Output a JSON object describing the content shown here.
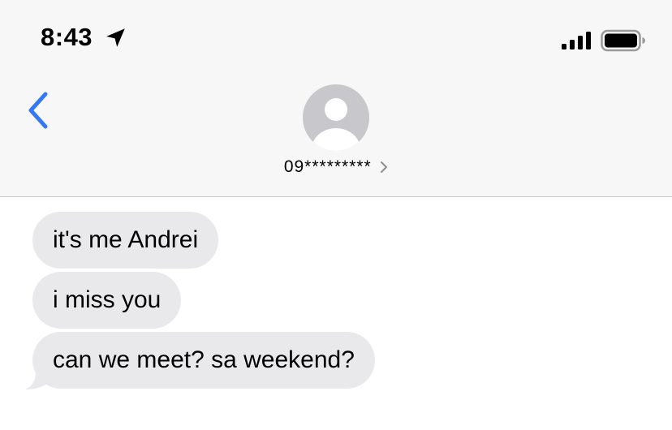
{
  "status_bar": {
    "time": "8:43",
    "icons": [
      "location-arrow-icon",
      "cellular-signal-icon",
      "battery-icon"
    ]
  },
  "nav": {
    "back_icon": "chevron-left-icon",
    "avatar_icon": "person-silhouette-icon",
    "contact": "09*********",
    "contact_chevron": "chevron-right-icon"
  },
  "messages": [
    {
      "text": "it's me Andrei",
      "direction": "incoming"
    },
    {
      "text": "i miss you",
      "direction": "incoming"
    },
    {
      "text": "can we meet? sa weekend?",
      "direction": "incoming"
    }
  ],
  "colors": {
    "accent": "#3478f6",
    "header_bg": "#f7f7f7",
    "bubble_incoming": "#e9e9eb",
    "avatar_bg": "#c7c7cc",
    "divider": "#c8c8cc"
  }
}
